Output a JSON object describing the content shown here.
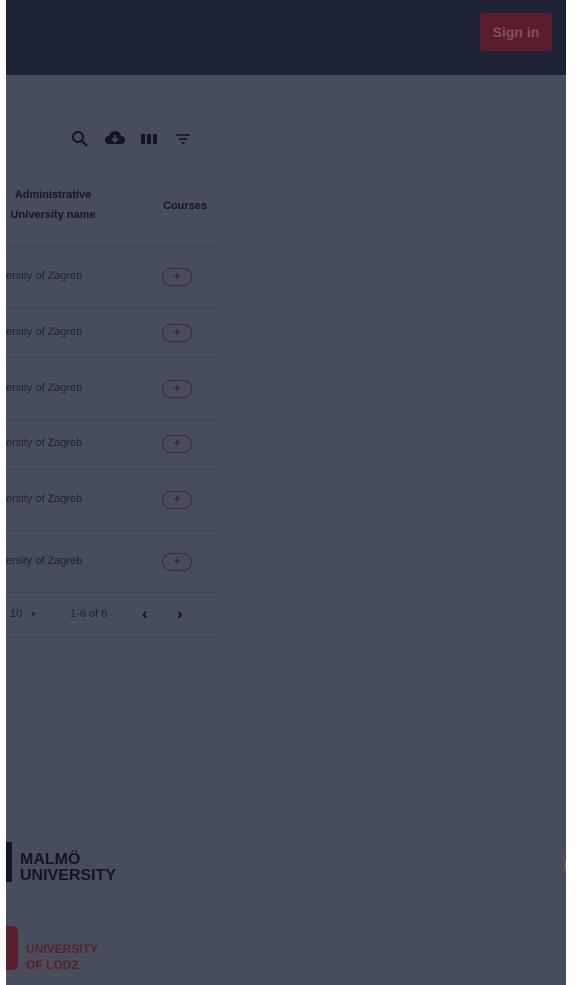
{
  "header": {
    "signin_label": "Sign in"
  },
  "toolbar": {
    "icons": [
      "search-icon",
      "cloud-download-icon",
      "columns-icon",
      "filter-icon"
    ]
  },
  "table": {
    "headers": [
      "Administrative University name",
      "Courses"
    ],
    "header_line1": "Administrative",
    "header_line2": "University name",
    "courses_header": "Courses",
    "rows": [
      {
        "university": "ersity of Zagreb",
        "action": "+"
      },
      {
        "university": "ersity of Zagreb",
        "action": "+"
      },
      {
        "university": "ersity of Zagreb",
        "action": "+"
      },
      {
        "university": "ersity of Zagreb",
        "action": "+"
      },
      {
        "university": "ersity of Zagreb",
        "action": "+"
      },
      {
        "university": "ersity of Zagreb",
        "action": "+"
      }
    ]
  },
  "pagination": {
    "rows_per_page": "10",
    "range": "1-6 of 6",
    "prev": "‹",
    "next": "›"
  },
  "logos": {
    "malmo_line1": "MALMÖ",
    "malmo_line2": "UNIVERSITY",
    "lodz_line1": "UNIVERSITY",
    "lodz_line2": "OF LODZ"
  }
}
